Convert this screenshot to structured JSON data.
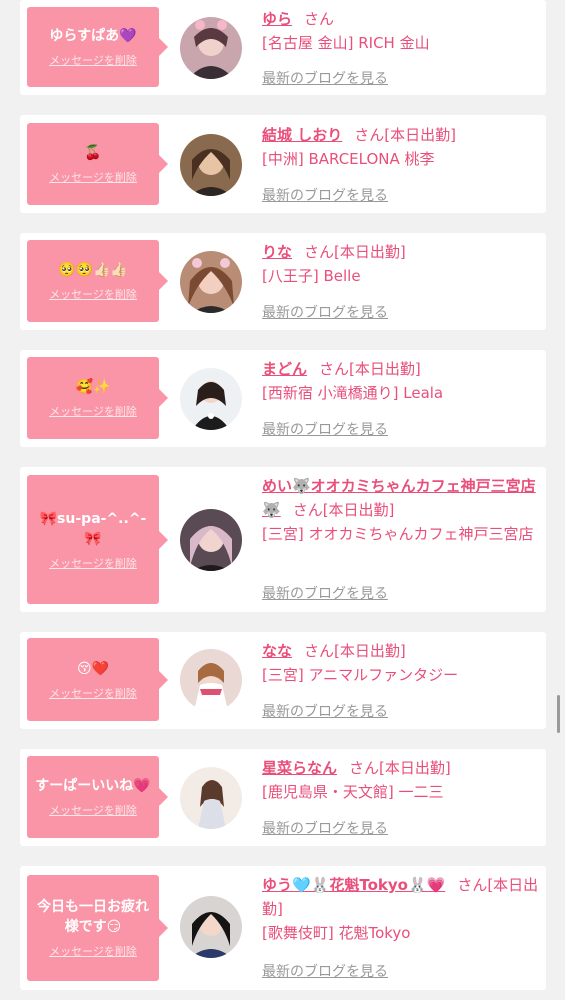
{
  "delete_label": "メッセージを削除",
  "blog_label": "最新のブログを見る",
  "san": "さん",
  "accent_color": "#fa95a7",
  "name_color": "#e94f7a",
  "cards": [
    {
      "message": "ゆらすぱあ💜",
      "name": "ゆら",
      "suffix": "さん",
      "shop": "[名古屋 金山] RICH 金山"
    },
    {
      "message": "🍒",
      "name": "結城 しおり",
      "suffix": "さん[本日出勤]",
      "shop": "[中洲] BARCELONA 桃李"
    },
    {
      "message": "🥺🥺👍🏻👍🏻",
      "name": "りな",
      "suffix": "さん[本日出勤]",
      "shop": "[八王子] Belle"
    },
    {
      "message": "🥰✨",
      "name": "まどん",
      "suffix": "さん[本日出勤]",
      "shop": "[西新宿 小滝橋通り] Leala"
    },
    {
      "message": "🎀su-pa-^..^-🎀",
      "name": "めい🐺オオカミちゃんカフェ神戸三宮店🐺",
      "suffix": "さん[本日出勤]",
      "shop": "[三宮] オオカミちゃんカフェ神戸三宮店"
    },
    {
      "message": "😚❤️",
      "name": "なな",
      "suffix": "さん[本日出勤]",
      "shop": "[三宮] アニマルファンタジー"
    },
    {
      "message": "すーぱーいいね💗",
      "name": "星菜らなん",
      "suffix": "さん[本日出勤]",
      "shop": "[鹿児島県・天文館] 一二三"
    },
    {
      "message": "今日も一日お疲れ様です😏",
      "name": "ゆう🩵🐰花魁Tokyo🐰💗",
      "suffix": "さん[本日出勤]",
      "shop": "[歌舞伎町] 花魁Tokyo"
    }
  ]
}
